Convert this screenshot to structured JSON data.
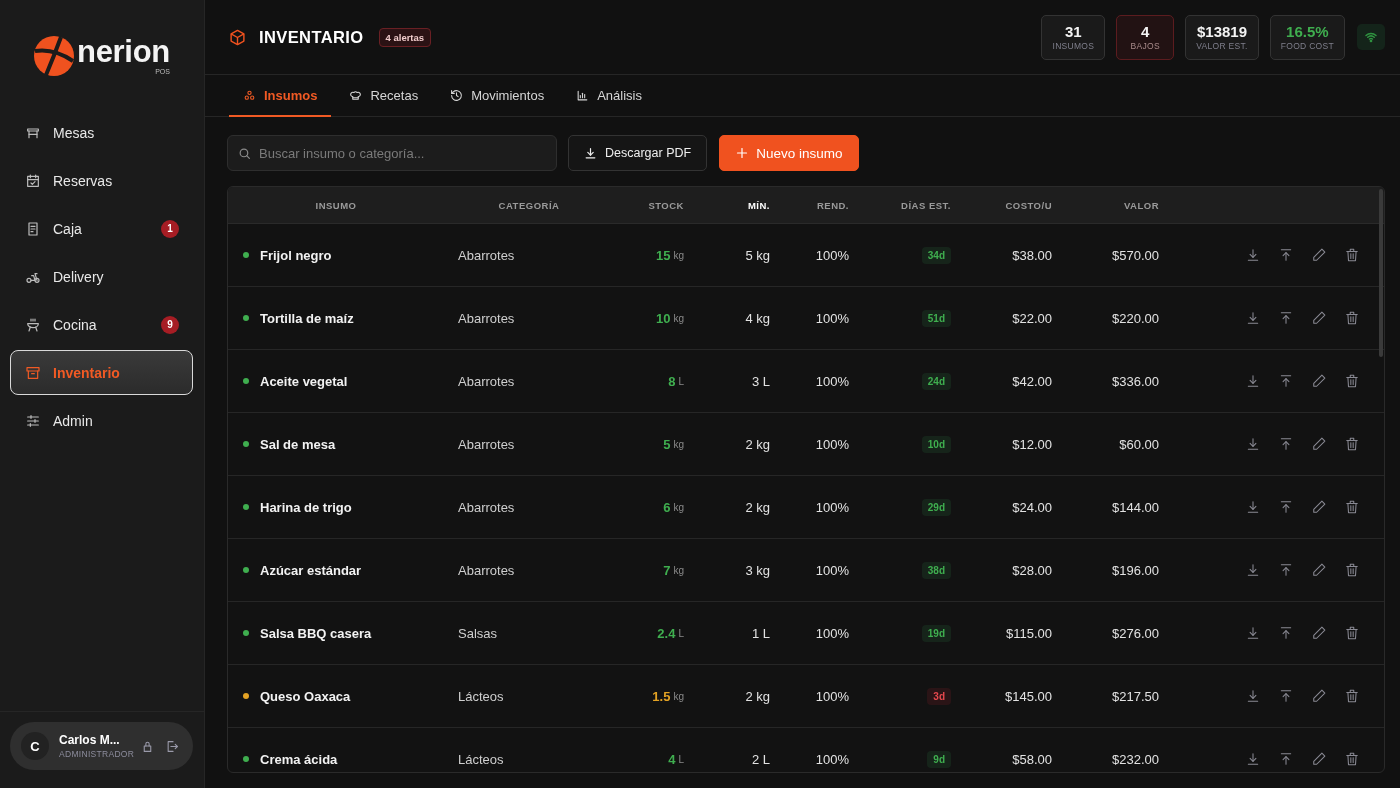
{
  "sidebar": {
    "logo": {
      "name": "nerion",
      "sub": "POS"
    },
    "items": [
      {
        "label": "Mesas",
        "selected": false
      },
      {
        "label": "Reservas",
        "selected": false
      },
      {
        "label": "Caja",
        "selected": false,
        "badge": "1"
      },
      {
        "label": "Delivery",
        "selected": false
      },
      {
        "label": "Cocina",
        "selected": false,
        "badge": "9"
      },
      {
        "label": "Inventario",
        "selected": true
      },
      {
        "label": "Admin",
        "selected": false
      }
    ],
    "user": {
      "initial": "C",
      "name": "Carlos M...",
      "role": "ADMINISTRADOR"
    }
  },
  "header": {
    "title": "INVENTARIO",
    "alert_badge": "4 alertas",
    "stats": [
      {
        "value": "31",
        "label": "INSUMOS",
        "kind": "plain"
      },
      {
        "value": "4",
        "label": "BAJOS",
        "kind": "alert"
      },
      {
        "value": "$13819",
        "label": "VALOR EST.",
        "kind": "plain"
      },
      {
        "value": "16.5%",
        "label": "FOOD COST",
        "kind": "positive"
      }
    ],
    "connection": {
      "online": true
    }
  },
  "tabs": [
    {
      "label": "Insumos",
      "selected": true
    },
    {
      "label": "Recetas",
      "selected": false
    },
    {
      "label": "Movimientos",
      "selected": false
    },
    {
      "label": "Análisis",
      "selected": false
    }
  ],
  "toolbar": {
    "search": {
      "placeholder": "Buscar insumo o categoría..."
    },
    "buttons": [
      {
        "label": "Descargar PDF",
        "kind": "secondary"
      },
      {
        "label": "Nuevo insumo",
        "kind": "primary"
      }
    ]
  },
  "table": {
    "columns": [
      {
        "label": "INSUMO",
        "sorted": false
      },
      {
        "label": "CATEGORÍA",
        "sorted": false
      },
      {
        "label": "STOCK",
        "sorted": false
      },
      {
        "label": "MÍN.",
        "sorted": true
      },
      {
        "label": "REND.",
        "sorted": false
      },
      {
        "label": "DÍAS EST.",
        "sorted": false
      },
      {
        "label": "COSTO/U",
        "sorted": false
      },
      {
        "label": "VALOR",
        "sorted": false
      }
    ],
    "rows": [
      {
        "name": "Frijol negro",
        "category": "Abarrotes",
        "stock": {
          "value": "15",
          "unit": "kg"
        },
        "min": "5 kg",
        "yield": "100%",
        "days": "34d",
        "days_alert": false,
        "cost": "$38.00",
        "value": "$570.00",
        "color": "#3fae4f"
      },
      {
        "name": "Tortilla de maíz",
        "category": "Abarrotes",
        "stock": {
          "value": "10",
          "unit": "kg"
        },
        "min": "4 kg",
        "yield": "100%",
        "days": "51d",
        "days_alert": false,
        "cost": "$22.00",
        "value": "$220.00",
        "color": "#3fae4f"
      },
      {
        "name": "Aceite vegetal",
        "category": "Abarrotes",
        "stock": {
          "value": "8",
          "unit": "L"
        },
        "min": "3 L",
        "yield": "100%",
        "days": "24d",
        "days_alert": false,
        "cost": "$42.00",
        "value": "$336.00",
        "color": "#3fae4f"
      },
      {
        "name": "Sal de mesa",
        "category": "Abarrotes",
        "stock": {
          "value": "5",
          "unit": "kg"
        },
        "min": "2 kg",
        "yield": "100%",
        "days": "10d",
        "days_alert": false,
        "cost": "$12.00",
        "value": "$60.00",
        "color": "#3fae4f"
      },
      {
        "name": "Harina de trigo",
        "category": "Abarrotes",
        "stock": {
          "value": "6",
          "unit": "kg"
        },
        "min": "2 kg",
        "yield": "100%",
        "days": "29d",
        "days_alert": false,
        "cost": "$24.00",
        "value": "$144.00",
        "color": "#3fae4f"
      },
      {
        "name": "Azúcar estándar",
        "category": "Abarrotes",
        "stock": {
          "value": "7",
          "unit": "kg"
        },
        "min": "3 kg",
        "yield": "100%",
        "days": "38d",
        "days_alert": false,
        "cost": "$28.00",
        "value": "$196.00",
        "color": "#3fae4f"
      },
      {
        "name": "Salsa BBQ casera",
        "category": "Salsas",
        "stock": {
          "value": "2.4",
          "unit": "L"
        },
        "min": "1 L",
        "yield": "100%",
        "days": "19d",
        "days_alert": false,
        "cost": "$115.00",
        "value": "$276.00",
        "color": "#3fae4f"
      },
      {
        "name": "Queso Oaxaca",
        "category": "Lácteos",
        "stock": {
          "value": "1.5",
          "unit": "kg"
        },
        "min": "2 kg",
        "yield": "100%",
        "days": "3d",
        "days_alert": true,
        "cost": "$145.00",
        "value": "$217.50",
        "color": "#e3a224"
      },
      {
        "name": "Crema ácida",
        "category": "Lácteos",
        "stock": {
          "value": "4",
          "unit": "L"
        },
        "min": "2 L",
        "yield": "100%",
        "days": "9d",
        "days_alert": false,
        "cost": "$58.00",
        "value": "$232.00",
        "color": "#3fae4f"
      }
    ]
  }
}
